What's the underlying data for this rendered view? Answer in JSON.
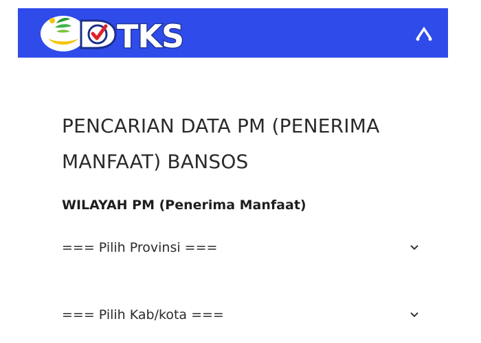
{
  "header": {
    "logo_text": "DTKS",
    "toggle_icon": "collapse-caret-icon",
    "background_color": "#2f4bea"
  },
  "main": {
    "title": "PENCARIAN DATA PM (PENERIMA MANFAAT) BANSOS",
    "section_label": "WILAYAH PM (Penerima Manfaat)",
    "province_select": {
      "selected": "=== Pilih Provinsi ===",
      "icon": "chevron-down-icon"
    },
    "city_select": {
      "selected": "=== Pilih Kab/kota ===",
      "icon": "chevron-down-icon"
    }
  }
}
